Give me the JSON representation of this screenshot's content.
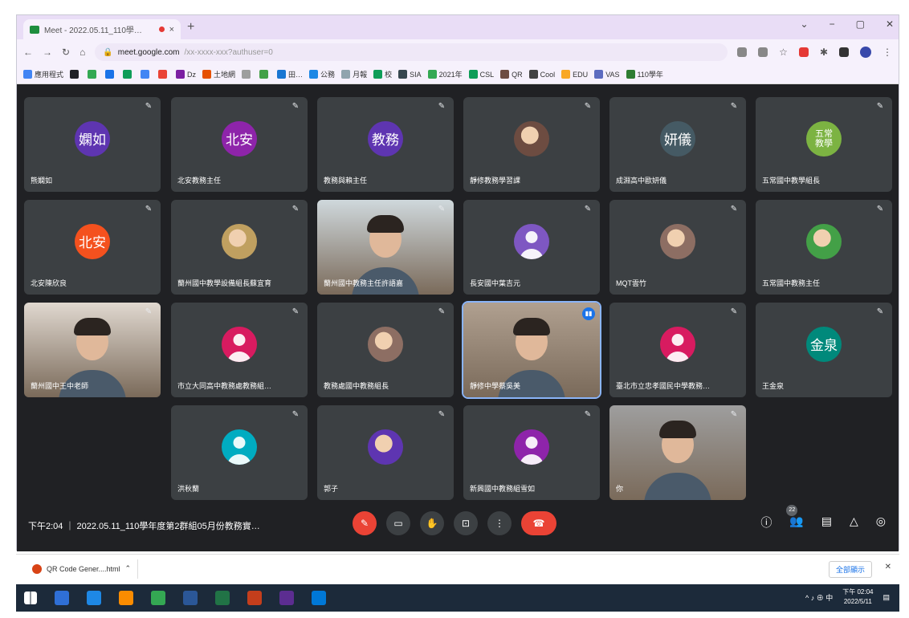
{
  "browser": {
    "tab_title": "Meet - 2022.05.11_110學…",
    "tab_close": "×",
    "new_tab": "+",
    "window_controls": [
      "⌄",
      "−",
      "▢",
      "✕"
    ],
    "url_host": "meet.google.com",
    "url_rest": "/xx-xxxx-xxx?authuser=0",
    "bookmarks": [
      {
        "label": "應用程式",
        "color": "#4285f4"
      },
      {
        "label": "",
        "color": "#202124"
      },
      {
        "label": "",
        "color": "#34a853"
      },
      {
        "label": "",
        "color": "#1a73e8"
      },
      {
        "label": "",
        "color": "#0f9d58"
      },
      {
        "label": "",
        "color": "#4285f4"
      },
      {
        "label": "",
        "color": "#ea4335"
      },
      {
        "label": "Dz",
        "color": "#7b1fa2"
      },
      {
        "label": "土地網",
        "color": "#e65100"
      },
      {
        "label": "",
        "color": "#9e9e9e"
      },
      {
        "label": "",
        "color": "#43a047"
      },
      {
        "label": "田…",
        "color": "#1976d2"
      },
      {
        "label": "公務",
        "color": "#1e88e5"
      },
      {
        "label": "月報",
        "color": "#90a4ae"
      },
      {
        "label": "校",
        "color": "#0f9d58"
      },
      {
        "label": "SIA",
        "color": "#37474f"
      },
      {
        "label": "2021年",
        "color": "#34a853"
      },
      {
        "label": "CSL",
        "color": "#0f9d58"
      },
      {
        "label": "QR",
        "color": "#6d4c41"
      },
      {
        "label": "Cool",
        "color": "#424242"
      },
      {
        "label": "EDU",
        "color": "#f9a825"
      },
      {
        "label": "VAS",
        "color": "#5c6bc0"
      },
      {
        "label": "110學年",
        "color": "#2e7d32"
      }
    ]
  },
  "participants": [
    {
      "name": "熊嫻如",
      "initials": "嫻如",
      "color": "#5e35b1",
      "kind": "initials"
    },
    {
      "name": "北安教務主任",
      "initials": "北安",
      "color": "#8e24aa",
      "kind": "initials"
    },
    {
      "name": "教務與賴主任",
      "initials": "教務",
      "color": "#5e35b1",
      "kind": "initials"
    },
    {
      "name": "靜修教務學習課",
      "initials": "",
      "color": "#6d4c41",
      "kind": "photo"
    },
    {
      "name": "成淵高中歐妍儀",
      "initials": "妍儀",
      "color": "#455a64",
      "kind": "initials"
    },
    {
      "name": "五常國中教學組長",
      "initials": "五常教學",
      "color": "#7cb342",
      "kind": "initials"
    },
    {
      "name": "北安陳欣良",
      "initials": "北安",
      "color": "#f4511e",
      "kind": "initials"
    },
    {
      "name": "蘭州國中教學設備組長蘇宜育",
      "initials": "",
      "color": "#c0a060",
      "kind": "photo"
    },
    {
      "name": "蘭州國中教務主任許語嘉",
      "initials": "",
      "color": "#cfd8dc",
      "kind": "video"
    },
    {
      "name": "長安國中葉吉元",
      "initials": "",
      "color": "#7e57c2",
      "kind": "person"
    },
    {
      "name": "MQT雲竹",
      "initials": "",
      "color": "#8d6e63",
      "kind": "photo"
    },
    {
      "name": "五常國中教務主任",
      "initials": "",
      "color": "#43a047",
      "kind": "photo"
    },
    {
      "name": "蘭州國中王中老師",
      "initials": "",
      "color": "#e0d8d0",
      "kind": "video"
    },
    {
      "name": "市立大同高中教務處教務組…",
      "initials": "",
      "color": "#d81b60",
      "kind": "person"
    },
    {
      "name": "教務處國中教務組長",
      "initials": "",
      "color": "#8d6e63",
      "kind": "photo"
    },
    {
      "name": "靜修中學蔡吳美",
      "initials": "",
      "color": "#b0a090",
      "kind": "video"
    },
    {
      "name": "臺北市立忠孝國民中學教務…",
      "initials": "",
      "color": "#d81b60",
      "kind": "person"
    },
    {
      "name": "王金泉",
      "initials": "金泉",
      "color": "#00897b",
      "kind": "initials"
    },
    {
      "name": "洪秋蘭",
      "initials": "",
      "color": "#00acc1",
      "kind": "person"
    },
    {
      "name": "郭子",
      "initials": "",
      "color": "#5e35b1",
      "kind": "photo"
    },
    {
      "name": "新興國中教務組雪如",
      "initials": "",
      "color": "#8e24aa",
      "kind": "person"
    },
    {
      "name": "你",
      "initials": "",
      "color": "#9e9e9e",
      "kind": "video"
    }
  ],
  "meet_bar": {
    "info": "下午2:04 ｜ 2022.05.11_110學年度第2群組05月份教務實…",
    "controls": [
      {
        "id": "mic",
        "glyph": "✎",
        "style": "red"
      },
      {
        "id": "camera",
        "glyph": "▭",
        "style": ""
      },
      {
        "id": "hand",
        "glyph": "✋",
        "style": ""
      },
      {
        "id": "present",
        "glyph": "⊡",
        "style": ""
      },
      {
        "id": "more",
        "glyph": "⋮",
        "style": ""
      },
      {
        "id": "end",
        "glyph": "☎",
        "style": "end"
      }
    ],
    "participant_count": "22",
    "right_icons": [
      "ⓘ",
      "👥",
      "▤",
      "△",
      "◎"
    ]
  },
  "downloads": {
    "item_label": "QR Code Gener....html",
    "chevron": "⌃",
    "show_all": "全部顯示",
    "close": "✕"
  },
  "taskbar": {
    "apps": [
      "#2f6fd6",
      "#1e88e5",
      "#fb8c00",
      "#34a853",
      "#2b5797",
      "#217346",
      "#c43e1c",
      "#5c2d91",
      "#0078d7"
    ],
    "tray_text": "^ ♪ ⊕ 中",
    "time": "下午 02:04",
    "date": "2022/5/11"
  }
}
